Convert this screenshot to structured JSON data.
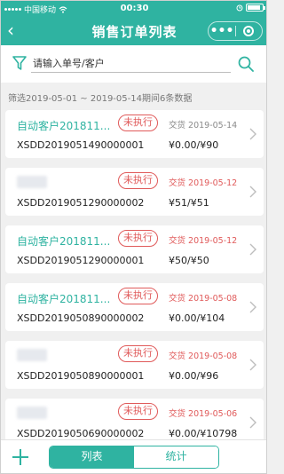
{
  "status_bar": {
    "carrier": "中国移动",
    "time": "00:30",
    "battery_level": 0.85
  },
  "nav": {
    "back_glyph": "‹",
    "title": "销售订单列表",
    "more_glyph": "•••"
  },
  "search": {
    "placeholder": "请输入单号/客户",
    "value": ""
  },
  "summary": "筛选2019-05-01 ~ 2019-05-14期间6条数据",
  "orders": [
    {
      "customer": "自动客户201811...",
      "customer_blurred": false,
      "status": "未执行",
      "date_text": "交货 2019-05-14",
      "date_color": "grey",
      "code": "XSDD2019051490000001",
      "amount": "¥0.00/¥90"
    },
    {
      "customer": "",
      "customer_blurred": true,
      "status": "未执行",
      "date_text": "交货 2019-05-12",
      "date_color": "red",
      "code": "XSDD2019051290000002",
      "amount": "¥51/¥51"
    },
    {
      "customer": "自动客户201811...",
      "customer_blurred": false,
      "status": "未执行",
      "date_text": "交货 2019-05-12",
      "date_color": "red",
      "code": "XSDD2019051290000001",
      "amount": "¥50/¥50"
    },
    {
      "customer": "自动客户201811...",
      "customer_blurred": false,
      "status": "未执行",
      "date_text": "交货 2019-05-08",
      "date_color": "red",
      "code": "XSDD2019050890000002",
      "amount": "¥0.00/¥104"
    },
    {
      "customer": "",
      "customer_blurred": true,
      "status": "未执行",
      "date_text": "交货 2019-05-08",
      "date_color": "red",
      "code": "XSDD2019050890000001",
      "amount": "¥0.00/¥96"
    },
    {
      "customer": "",
      "customer_blurred": true,
      "status": "未执行",
      "date_text": "交货 2019-05-06",
      "date_color": "red",
      "code": "XSDD2019050690000002",
      "amount": "¥0.00/¥10798"
    }
  ],
  "bottom": {
    "add_icon": "plus-icon",
    "tabs": [
      {
        "label": "列表",
        "active": true
      },
      {
        "label": "统计",
        "active": false
      }
    ]
  },
  "colors": {
    "accent": "#2fb3a1",
    "status_red": "#e05a5a",
    "background": "#f0f0f0"
  }
}
